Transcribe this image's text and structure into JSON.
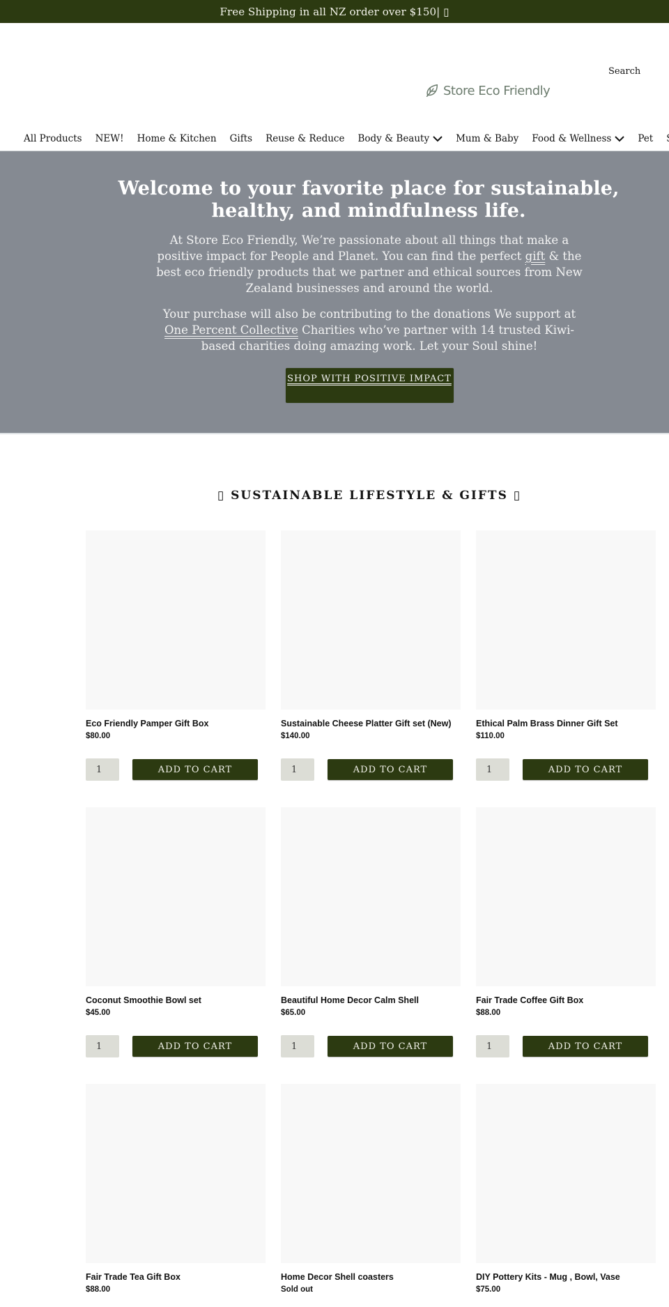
{
  "announcement": {
    "text": "Free Shipping in all NZ order over $150| ▯"
  },
  "header": {
    "search_label": "Search",
    "logo_icon": "leaf-icon",
    "logo_text": "Store Eco Friendly"
  },
  "nav": {
    "items": [
      {
        "label": "All Products",
        "dropdown": false
      },
      {
        "label": "NEW!",
        "dropdown": false
      },
      {
        "label": "Home & Kitchen",
        "dropdown": false
      },
      {
        "label": "Gifts",
        "dropdown": false
      },
      {
        "label": "Reuse & Reduce",
        "dropdown": false
      },
      {
        "label": "Body & Beauty",
        "dropdown": true
      },
      {
        "label": "Mum & Baby",
        "dropdown": false
      },
      {
        "label": "Food & Wellness",
        "dropdown": true
      },
      {
        "label": "Pet",
        "dropdown": false
      },
      {
        "label": "SALE",
        "dropdown": false
      }
    ]
  },
  "hero": {
    "title": "Welcome to your favorite place for sustainable, healthy, and mindfulness life.",
    "para1_before": "At Store Eco Friendly, We’re passionate about all things that make a positive impact for People and Planet. You can find the perfect ",
    "para1_link": "gift",
    "para1_after": " & the best eco friendly products that we partner and ethical sources from New Zealand businesses and around the world.",
    "para2_before": "Your purchase will also be contributing to the donations We support at ",
    "para2_link": "One Percent Collective",
    "para2_after": " Charities who’ve partner with 14 trusted Kiwi-based charities doing amazing work. Let your Soul shine!",
    "cta_label": "SHOP WITH POSITIVE IMPACT"
  },
  "collection": {
    "title": "▯ SUSTAINABLE LIFESTYLE & GIFTS ▯",
    "products": [
      {
        "title": "Eco Friendly Pamper Gift Box",
        "price": "$80.00",
        "qty": "1",
        "button": "ADD TO CART"
      },
      {
        "title": "Sustainable Cheese Platter Gift set (New)",
        "price": "$140.00",
        "qty": "1",
        "button": "ADD TO CART"
      },
      {
        "title": "Ethical Palm Brass Dinner Gift Set",
        "price": "$110.00",
        "qty": "1",
        "button": "ADD TO CART"
      },
      {
        "title": "Coconut Smoothie Bowl set",
        "price": "$45.00",
        "qty": "1",
        "button": "ADD TO CART"
      },
      {
        "title": "Beautiful Home Decor Calm Shell",
        "price": "$65.00",
        "qty": "1",
        "button": "ADD TO CART"
      },
      {
        "title": "Fair Trade Coffee Gift Box",
        "price": "$88.00",
        "qty": "1",
        "button": "ADD TO CART"
      },
      {
        "title": "Fair Trade Tea Gift Box",
        "price": "$88.00"
      },
      {
        "title": "Home Decor Shell coasters",
        "price": "Sold out"
      },
      {
        "title": "DIY Pottery Kits - Mug , Bowl, Vase",
        "price": "$75.00"
      }
    ]
  },
  "colors": {
    "brand_dark_green": "#2c3a11",
    "hero_gray": "#858a92",
    "logo_gray_green": "#6c7c6e",
    "qty_bg": "#dcddd6",
    "image_placeholder": "#f8f8f8"
  }
}
